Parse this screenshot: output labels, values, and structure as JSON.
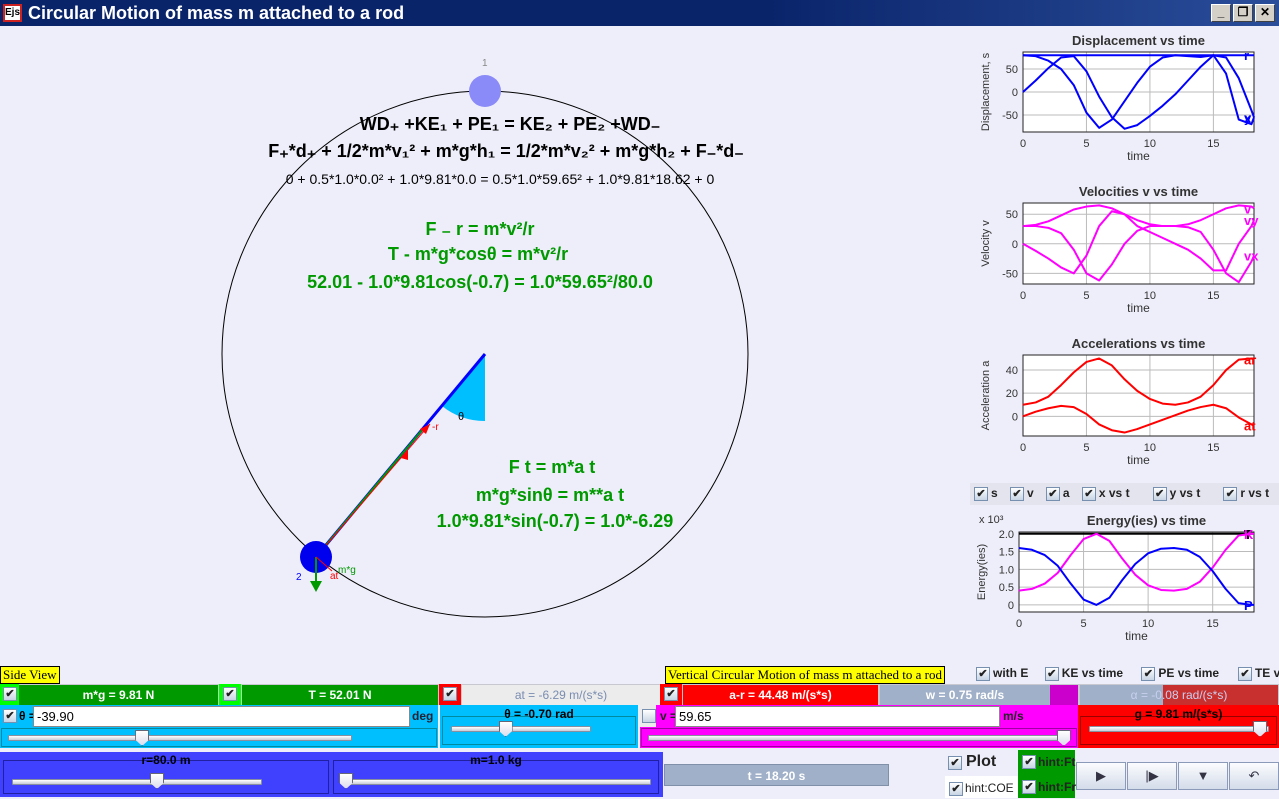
{
  "window": {
    "title": "Circular Motion of mass m attached to a rod",
    "logo": "Ejs",
    "buttons": [
      "minimize",
      "restore",
      "close"
    ]
  },
  "scene": {
    "mass1_label": "1",
    "mass2_label": "2",
    "theta_label": "θ",
    "fr_label": "-r",
    "at_label": "at",
    "mg_label": "m*g",
    "energy_eq": {
      "line1": "WD₊ +KE₁ + PE₁ =  KE₂ + PE₂ +WD₋",
      "line2": "F₊*d₊ + 1/2*m*v₁² + m*g*h₁ = 1/2*m*v₂² + m*g*h₂ + F₋*d₋",
      "line3": "0 + 0.5*1.0*0.0² + 1.0*9.81*0.0 = 0.5*1.0*59.65² + 1.0*9.81*18.62 + 0"
    },
    "radial_eq": {
      "line1": "F ₋ r = m*v²/r",
      "line2": "T - m*g*cosθ = m*v²/r",
      "line3": "52.01 - 1.0*9.81cos(-0.7) = 1.0*59.65²/80.0"
    },
    "tangential_eq": {
      "line1": "F t = m*a t",
      "line2": "m*g*sinθ = m**a t",
      "line3": "1.0*9.81*sin(-0.7) = 1.0*-6.29"
    },
    "theta_rad": -0.7
  },
  "chart_data": [
    {
      "type": "line",
      "title": "Displacement vs time",
      "xlabel": "time",
      "ylabel": "Displacement, s",
      "xlim": [
        0,
        18.2
      ],
      "ylim": [
        -87,
        87
      ],
      "xticks": [
        0,
        5,
        10,
        15
      ],
      "yticks": [
        50,
        0,
        -50
      ],
      "x": [
        0,
        1,
        2,
        3,
        4,
        5,
        6,
        7,
        8,
        9,
        10,
        11,
        12,
        13,
        14,
        15,
        16,
        17,
        18,
        18.2
      ],
      "series": [
        {
          "name": "x",
          "color": "#0000ff",
          "end_label": "x",
          "values": [
            80,
            78,
            68,
            50,
            15,
            -45,
            -78,
            -60,
            -20,
            20,
            55,
            75,
            80,
            78,
            76,
            80,
            40,
            -60,
            -70,
            -55
          ]
        },
        {
          "name": "y",
          "color": "#0000ff",
          "end_label": "y",
          "values": [
            0,
            25,
            52,
            75,
            78,
            45,
            -10,
            -55,
            -80,
            -72,
            -52,
            -30,
            -5,
            25,
            55,
            80,
            75,
            30,
            -40,
            -55
          ]
        },
        {
          "name": "r",
          "color": "#0000ff",
          "end_label": "r",
          "values": [
            80,
            80,
            80,
            80,
            80,
            80,
            80,
            80,
            80,
            80,
            80,
            80,
            80,
            80,
            80,
            80,
            80,
            80,
            80,
            80
          ]
        }
      ]
    },
    {
      "type": "line",
      "title": "Velocities v vs time",
      "xlabel": "time",
      "ylabel": "Velocity v",
      "xlim": [
        0,
        18.2
      ],
      "ylim": [
        -68,
        69
      ],
      "xticks": [
        0,
        5,
        10,
        15
      ],
      "yticks": [
        50,
        0,
        -50
      ],
      "x": [
        0,
        1,
        2,
        3,
        4,
        5,
        6,
        7,
        8,
        9,
        10,
        11,
        12,
        13,
        14,
        15,
        16,
        17,
        18,
        18.2
      ],
      "series": [
        {
          "name": "v",
          "color": "#ff00ff",
          "end_label": "v",
          "values": [
            30,
            32,
            38,
            48,
            58,
            63,
            65,
            60,
            50,
            40,
            33,
            30,
            30,
            33,
            40,
            50,
            60,
            65,
            63,
            60
          ]
        },
        {
          "name": "vx",
          "color": "#ff00ff",
          "end_label": "vx",
          "values": [
            30,
            30,
            27,
            18,
            -10,
            -50,
            -62,
            -35,
            0,
            22,
            30,
            30,
            30,
            28,
            20,
            -10,
            -50,
            -65,
            -30,
            -20
          ]
        },
        {
          "name": "vy",
          "color": "#ff00ff",
          "end_label": "vy",
          "values": [
            0,
            -12,
            -25,
            -40,
            -50,
            -20,
            30,
            55,
            50,
            30,
            20,
            10,
            0,
            -10,
            -25,
            -45,
            -45,
            0,
            30,
            40
          ]
        }
      ]
    },
    {
      "type": "line",
      "title": "Accelerations  vs time",
      "xlabel": "time",
      "ylabel": "Acceleration a",
      "xlim": [
        0,
        18.2
      ],
      "ylim": [
        -17,
        53
      ],
      "xticks": [
        0,
        5,
        10,
        15
      ],
      "yticks": [
        40,
        20,
        0
      ],
      "x": [
        0,
        1,
        2,
        3,
        4,
        5,
        6,
        7,
        8,
        9,
        10,
        11,
        12,
        13,
        14,
        15,
        16,
        17,
        18,
        18.2
      ],
      "series": [
        {
          "name": "ar",
          "color": "#ff0000",
          "end_label": "ar",
          "values": [
            10,
            12,
            17,
            27,
            38,
            47,
            50,
            44,
            32,
            22,
            15,
            11,
            10,
            12,
            17,
            27,
            40,
            49,
            50,
            49
          ]
        },
        {
          "name": "at",
          "color": "#ff0000",
          "end_label": "at",
          "values": [
            0,
            4,
            7,
            9,
            8,
            2,
            -7,
            -12,
            -14,
            -11,
            -7,
            -3,
            1,
            5,
            8,
            10,
            7,
            -1,
            -7,
            -8
          ]
        }
      ]
    },
    {
      "type": "line",
      "title": "Energy(ies) vs time",
      "xlabel": "time",
      "ylabel": "Energy(ies)",
      "yscale_label": "x 10³",
      "xlim": [
        0,
        18.2
      ],
      "ylim": [
        -0.2,
        2.05
      ],
      "xticks": [
        0,
        5,
        10,
        15
      ],
      "yticks": [
        2.0,
        1.5,
        1.0,
        0.5,
        0
      ],
      "x": [
        0,
        1,
        2,
        3,
        4,
        5,
        6,
        7,
        8,
        9,
        10,
        11,
        12,
        13,
        14,
        15,
        16,
        17,
        18,
        18.2
      ],
      "series": [
        {
          "name": "TE",
          "color": "#000000",
          "end_label": "T",
          "values": [
            2,
            2,
            2,
            2,
            2,
            2,
            2,
            2,
            2,
            2,
            2,
            2,
            2,
            2,
            2,
            2,
            2,
            2,
            2,
            2
          ]
        },
        {
          "name": "KE",
          "color": "#ff00ff",
          "end_label": "K",
          "values": [
            0.4,
            0.45,
            0.6,
            0.9,
            1.4,
            1.85,
            2.0,
            1.8,
            1.3,
            0.85,
            0.55,
            0.42,
            0.4,
            0.45,
            0.65,
            1.05,
            1.55,
            1.95,
            2.0,
            2.0
          ]
        },
        {
          "name": "PE",
          "color": "#0000ff",
          "end_label": "P",
          "values": [
            1.6,
            1.55,
            1.4,
            1.1,
            0.6,
            0.15,
            0.0,
            0.2,
            0.7,
            1.15,
            1.45,
            1.58,
            1.6,
            1.55,
            1.35,
            0.95,
            0.45,
            0.05,
            0.0,
            0.0
          ]
        }
      ]
    }
  ],
  "plot_toggles": [
    {
      "label": "s",
      "checked": true
    },
    {
      "label": "v",
      "checked": true
    },
    {
      "label": "a",
      "checked": true
    },
    {
      "label": "x vs t",
      "checked": true
    },
    {
      "label": "y vs t",
      "checked": true
    },
    {
      "label": "r vs t",
      "checked": true
    }
  ],
  "energy_toggles": [
    {
      "label": "with E",
      "checked": true
    },
    {
      "label": "KE vs time",
      "checked": true
    },
    {
      "label": "PE vs time",
      "checked": true
    },
    {
      "label": "TE vs time",
      "checked": true
    }
  ],
  "controls": {
    "side_view": "Side View",
    "caption": "Vertical Circular Motion of mass m attached to a rod",
    "mg": "m*g = 9.81 N",
    "T": "T = 52.01 N",
    "at": "at = -6.29 m/(s*s)",
    "ar": "a-r = 44.48 m/(s*s)",
    "w": "w = 0.75 rad/s",
    "alpha": "α = -0.08 rad/(s*s)",
    "theta_label": "θ =",
    "theta_value": "-39.90",
    "theta_unit": "deg",
    "theta_rad_title": "θ = -0.70 rad",
    "v_label": "v =",
    "v_value": "59.65",
    "v_unit": "m/s",
    "g_title": "g = 9.81 m/(s*s)",
    "r_title": "r=80.0 m",
    "m_title": "m=1.0 kg",
    "time": "t = 18.20 s",
    "plot": "Plot",
    "hint_coe": "hint:COE",
    "hint_ft": "hint:Ft",
    "hint_fr": "hint:Fr",
    "theta_slider": 0.39,
    "theta_rad_slider": 0.39,
    "v_slider": 0.99,
    "g_slider": 0.95,
    "r_slider": 0.58,
    "m_slider": 0.0
  },
  "check_mark": "✔",
  "playback": [
    "play",
    "step",
    "dropdown",
    "reset"
  ]
}
